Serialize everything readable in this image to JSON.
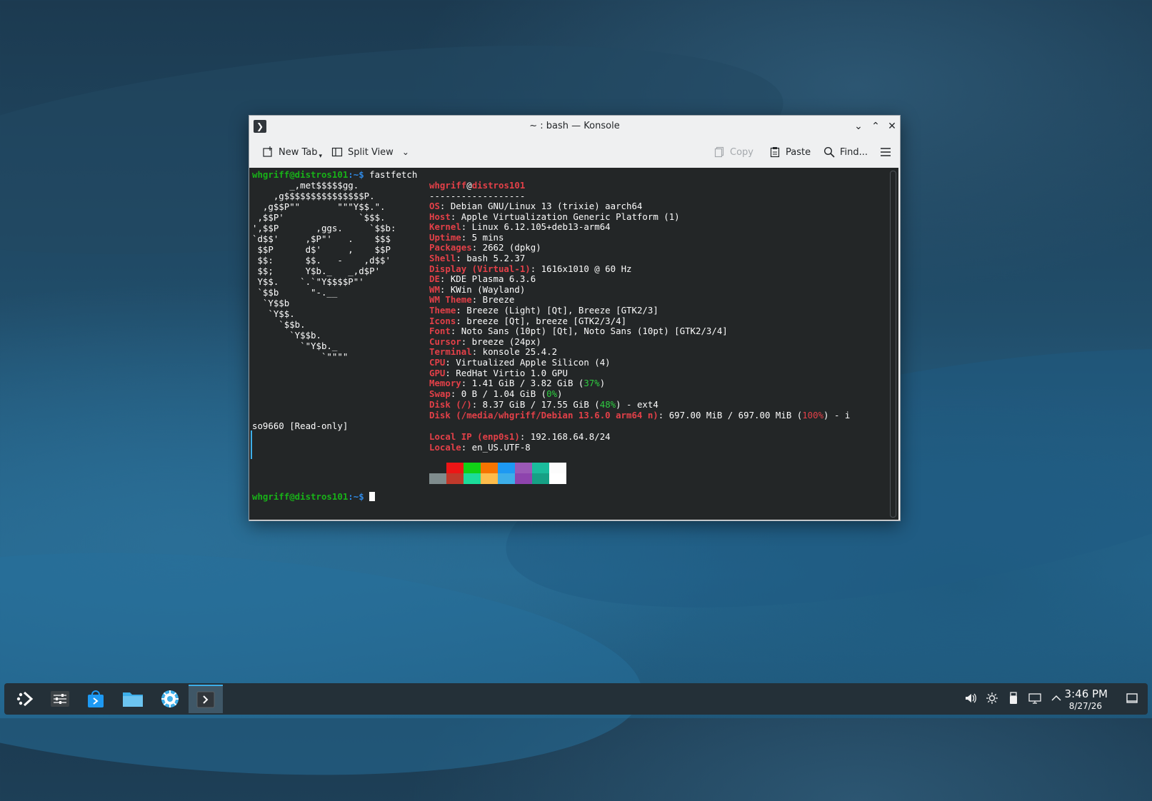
{
  "window": {
    "title": "~ : bash — Konsole",
    "app_icon": "terminal-icon"
  },
  "toolbar": {
    "new_tab": "New Tab",
    "split_view": "Split View",
    "copy": "Copy",
    "paste": "Paste",
    "find": "Find..."
  },
  "terminal": {
    "prompt_user": "whgriff@distros101",
    "prompt_path": ":~$",
    "command": "fastfetch",
    "logo": [
      "       _,met$$$$$gg.",
      "    ,g$$$$$$$$$$$$$$$P.",
      "  ,g$$P\"\"       \"\"\"Y$$.\".",
      " ,$$P'              `$$$.",
      "',$$P       ,ggs.     `$$b:",
      "`d$$'     ,$P\"'   .    $$$",
      " $$P      d$'     ,    $$P",
      " $$:      $$.   -    ,d$$'",
      " $$;      Y$b._   _,d$P'",
      " Y$$.    `.`\"Y$$$$P\"'",
      " `$$b      \"-.__",
      "  `Y$$b",
      "   `Y$$.",
      "     `$$b.",
      "       `Y$$b.",
      "         `\"Y$b._",
      "             `\"\"\"\""
    ],
    "header_user": "whgriff",
    "header_at": "@",
    "header_host": "distros101",
    "separator": "------------------",
    "info": [
      {
        "key": "OS",
        "value": ": Debian GNU/Linux 13 (trixie) aarch64"
      },
      {
        "key": "Host",
        "value": ": Apple Virtualization Generic Platform (1)"
      },
      {
        "key": "Kernel",
        "value": ": Linux 6.12.105+deb13-arm64"
      },
      {
        "key": "Uptime",
        "value": ": 5 mins"
      },
      {
        "key": "Packages",
        "value": ": 2662 (dpkg)"
      },
      {
        "key": "Shell",
        "value": ": bash 5.2.37"
      },
      {
        "key": "Display (Virtual-1)",
        "value": ": 1616x1010 @ 60 Hz"
      },
      {
        "key": "DE",
        "value": ": KDE Plasma 6.3.6"
      },
      {
        "key": "WM",
        "value": ": KWin (Wayland)"
      },
      {
        "key": "WM Theme",
        "value": ": Breeze"
      },
      {
        "key": "Theme",
        "value": ": Breeze (Light) [Qt], Breeze [GTK2/3]"
      },
      {
        "key": "Icons",
        "value": ": breeze [Qt], breeze [GTK2/3/4]"
      },
      {
        "key": "Font",
        "value": ": Noto Sans (10pt) [Qt], Noto Sans (10pt) [GTK2/3/4]"
      },
      {
        "key": "Cursor",
        "value": ": breeze (24px)"
      },
      {
        "key": "Terminal",
        "value": ": konsole 25.4.2"
      },
      {
        "key": "CPU",
        "value": ": Virtualized Apple Silicon (4)"
      },
      {
        "key": "GPU",
        "value": ": RedHat Virtio 1.0 GPU"
      }
    ],
    "memory": {
      "key": "Memory",
      "pre": ": 1.41 GiB / 3.82 GiB (",
      "pct": "37%",
      "post": ")"
    },
    "swap": {
      "key": "Swap",
      "pre": ": 0 B / 1.04 GiB (",
      "pct": "0%",
      "post": ")"
    },
    "disk1": {
      "key": "Disk (/)",
      "pre": ": 8.37 GiB / 17.55 GiB (",
      "pct": "48%",
      "post": ") - ext4"
    },
    "disk2": {
      "key": "Disk (/media/whgriff/Debian 13.6.0 arm64 n)",
      "pre": ": 697.00 MiB / 697.00 MiB (",
      "pct": "100%",
      "post": ") - i"
    },
    "wrap": "so9660 [Read-only]",
    "local_ip": {
      "key": "Local IP (enp0s1)",
      "value": ": 192.168.64.8/24"
    },
    "locale": {
      "key": "Locale",
      "value": ": en_US.UTF-8"
    },
    "palette_top": [
      "#232627",
      "#ed1515",
      "#11d116",
      "#f67400",
      "#1d99f3",
      "#9b59b6",
      "#1abc9c",
      "#fcfcfc"
    ],
    "palette_bottom": [
      "#7f8c8d",
      "#c0392b",
      "#1cdc9a",
      "#fdbc4b",
      "#3daee9",
      "#8e44ad",
      "#16a085",
      "#ffffff"
    ]
  },
  "taskbar": {
    "time": "3:46 PM",
    "date": "8/27/26",
    "launcher_icon": "kde-launcher-icon",
    "apps": [
      "system-settings-icon",
      "discover-store-icon",
      "dolphin-files-icon",
      "browser-icon",
      "konsole-terminal-icon"
    ],
    "tray": [
      "volume-icon",
      "brightness-icon",
      "usb-icon",
      "network-icon",
      "tray-expand-icon"
    ]
  }
}
